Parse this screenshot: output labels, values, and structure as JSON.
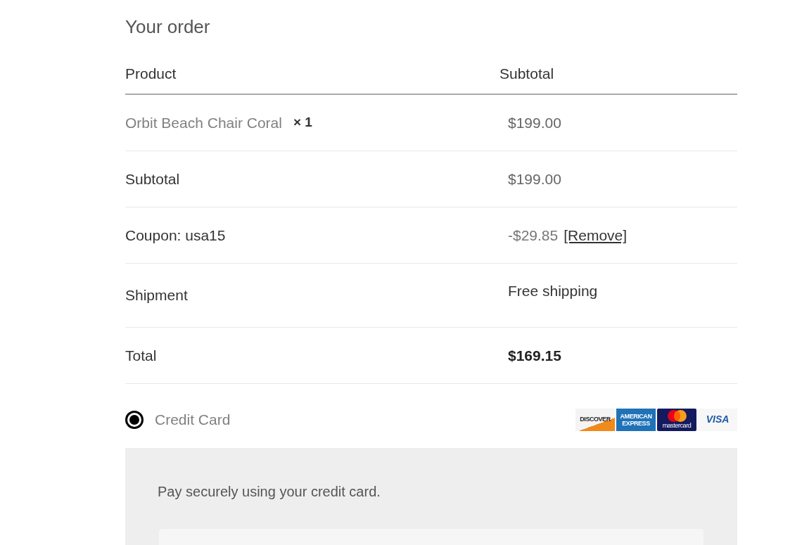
{
  "heading": "Your order",
  "order_table": {
    "columns": [
      "Product",
      "Subtotal"
    ],
    "items": [
      {
        "name": "Orbit Beach Chair Coral",
        "quantity": "× 1",
        "subtotal": "$199.00"
      }
    ],
    "totals": [
      {
        "kind": "subtotal",
        "label": "Subtotal",
        "value": "$199.00"
      },
      {
        "kind": "coupon",
        "label": "Coupon: usa15",
        "value": "-$29.85",
        "action": "[Remove]"
      },
      {
        "kind": "shipping",
        "label": "Shipment",
        "value": "Free shipping"
      },
      {
        "kind": "total",
        "label": "Total",
        "value": "$169.15"
      }
    ]
  },
  "payment_methods": [
    {
      "label": "Credit Card",
      "selected": true,
      "card_logos": [
        {
          "kind": "discover",
          "text": "DISCOVER"
        },
        {
          "kind": "amex",
          "text": "AMERICAN EXPRESS"
        },
        {
          "kind": "mastercard",
          "text": "mastercard"
        },
        {
          "kind": "visa",
          "text": "VISA"
        }
      ],
      "description": "Pay securely using your credit card."
    }
  ]
}
